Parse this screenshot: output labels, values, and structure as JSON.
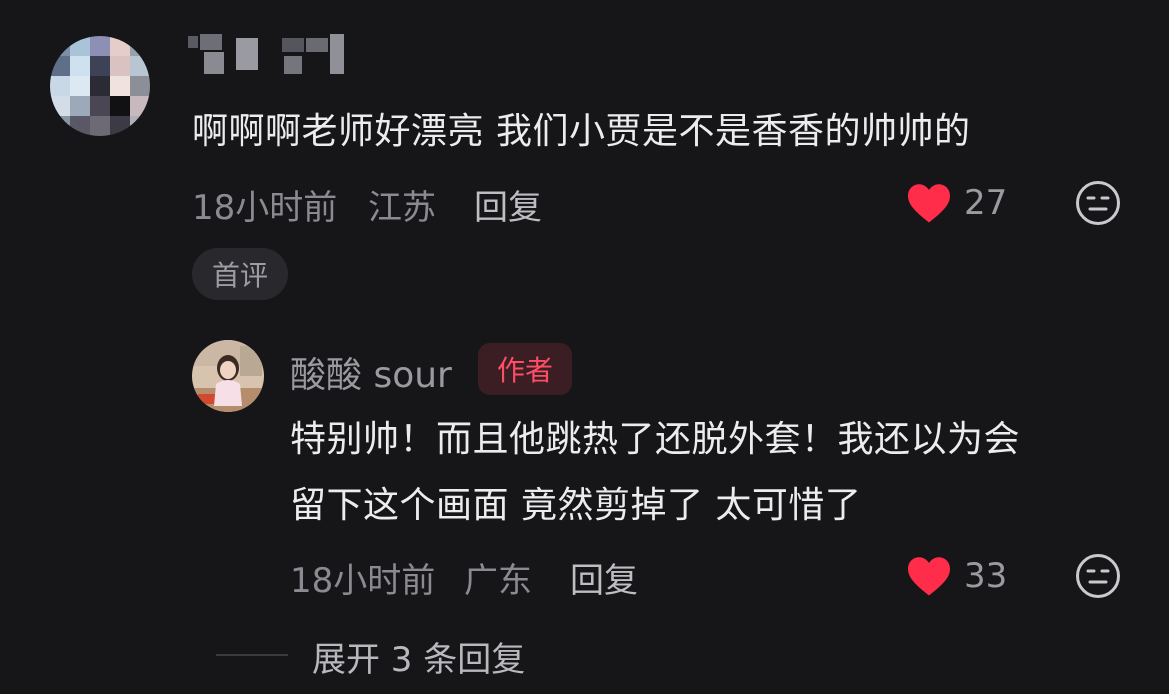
{
  "comment": {
    "text": "啊啊啊老师好漂亮 我们小贾是不是香香的帅帅的",
    "time": "18小时前",
    "location": "江苏",
    "reply_label": "回复",
    "like_count": "27",
    "first_badge": "首评"
  },
  "reply": {
    "author_name": "酸酸 sour",
    "author_badge": "作者",
    "text_line1": "特别帅！而且他跳热了还脱外套！我还以为会",
    "text_line2": "留下这个画面 竟然剪掉了 太可惜了",
    "time": "18小时前",
    "location": "广东",
    "reply_label": "回复",
    "like_count": "33"
  },
  "expand_label": "展开 3 条回复",
  "icons": {
    "like": "heart-icon",
    "dislike": "neutral-face-icon"
  },
  "colors": {
    "background": "#161619",
    "like_red": "#ff2d4a",
    "author_badge_text": "#ff4d66",
    "author_badge_bg": "#3a1e24"
  }
}
